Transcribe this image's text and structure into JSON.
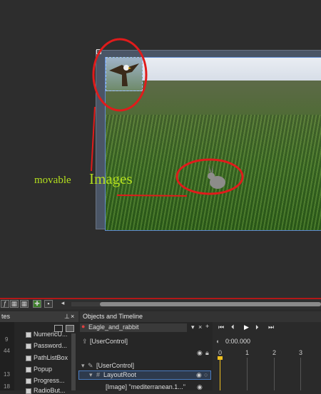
{
  "annotations": {
    "movable": "movable",
    "images": "Images"
  },
  "toolbar": {
    "artboard_icons": [
      "fx-icon",
      "grid-icon",
      "grid2-icon",
      "grid3-icon",
      "snap-icon",
      "comment-icon"
    ]
  },
  "states_panel": {
    "tab_label": "tes",
    "line_numbers": [
      "9",
      "44",
      "",
      "",
      "13",
      "18"
    ],
    "items": [
      "NumericU...",
      "Password...",
      "PathListBox",
      "Popup",
      "Progress...",
      "RadioBut..."
    ]
  },
  "objects_panel": {
    "title": "Objects and Timeline",
    "storyboard_name": "Eagle_and_rabbit",
    "usercontrol_root": "[UserControl]",
    "tree": [
      "[UserControl]",
      "LayoutRoot",
      "[Image] \"mediterranean.1...\""
    ]
  },
  "timeline_panel": {
    "time": "0:00.000",
    "ruler": [
      "0",
      "1",
      "2",
      "3"
    ]
  },
  "colors": {
    "annotation_red": "#e01b1b",
    "annotation_green": "#b4e01e",
    "selection_blue": "#5f8bd0",
    "playhead": "#f0c020"
  }
}
